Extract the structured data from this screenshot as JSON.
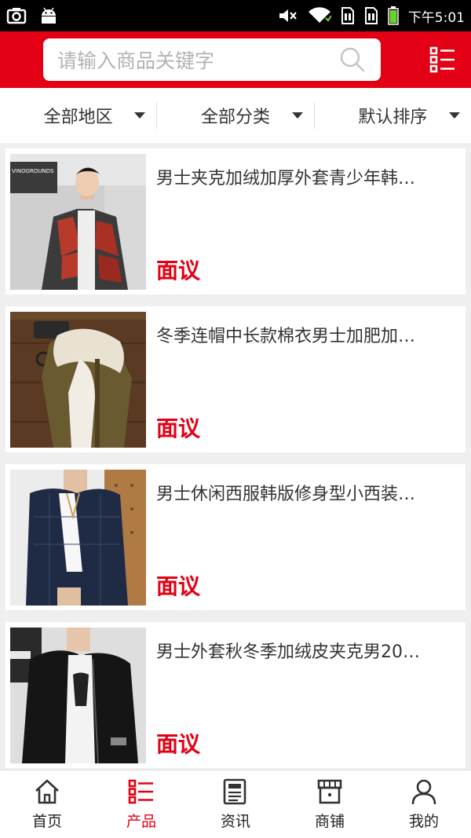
{
  "status_bar": {
    "time": "下午5:01",
    "icons": [
      "screenshot-icon",
      "android-icon",
      "mute-icon",
      "wifi-icon",
      "sim1-icon",
      "sim2-icon",
      "battery-icon"
    ]
  },
  "header": {
    "search_placeholder": "请输入商品关键字",
    "menu_icon": "category-menu-icon",
    "accent_color": "#e30014"
  },
  "filters": [
    {
      "label": "全部地区"
    },
    {
      "label": "全部分类"
    },
    {
      "label": "默认排序"
    }
  ],
  "products": [
    {
      "title": "男士夹克加绒加厚外套青少年韩…",
      "price": "面议",
      "image": "red-camo-jacket",
      "photo_text": "VINOGROUNDS"
    },
    {
      "title": "冬季连帽中长款棉衣男士加肥加…",
      "price": "面议",
      "image": "olive-fur-hood-parka"
    },
    {
      "title": "男士休闲西服韩版修身型小西装…",
      "price": "面议",
      "image": "navy-plaid-blazer"
    },
    {
      "title": "男士外套秋冬季加绒皮夹克男20…",
      "price": "面议",
      "image": "black-leather-jacket"
    }
  ],
  "bottom_nav": [
    {
      "label": "首页",
      "icon": "home-icon",
      "active": false
    },
    {
      "label": "产品",
      "icon": "product-list-icon",
      "active": true
    },
    {
      "label": "资讯",
      "icon": "news-icon",
      "active": false
    },
    {
      "label": "商铺",
      "icon": "shop-icon",
      "active": false
    },
    {
      "label": "我的",
      "icon": "user-icon",
      "active": false
    }
  ]
}
